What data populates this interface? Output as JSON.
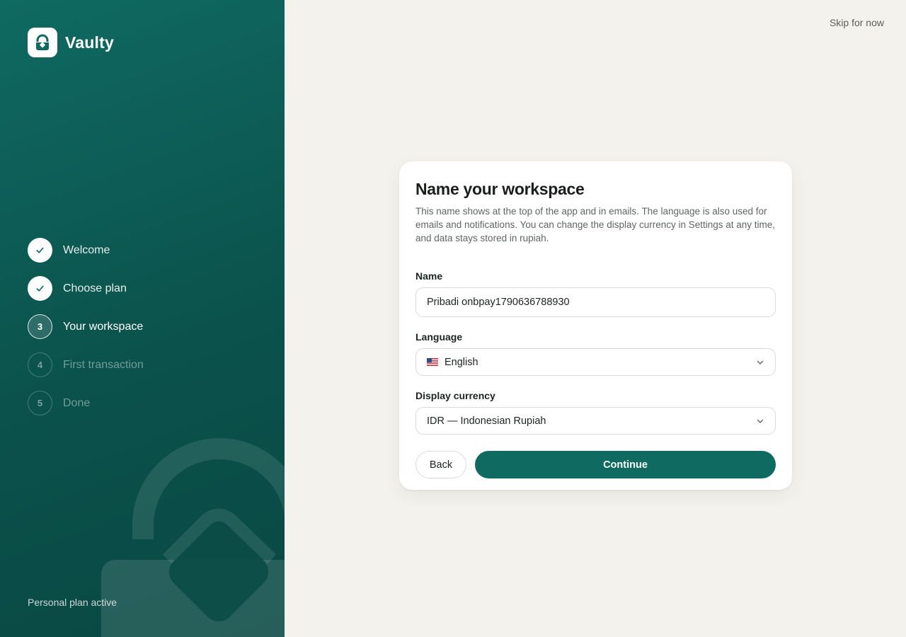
{
  "brand": {
    "name": "Vaulty",
    "icon": "lock-bag-icon"
  },
  "steps": [
    {
      "number": "1",
      "label": "Welcome",
      "state": "done"
    },
    {
      "number": "2",
      "label": "Choose plan",
      "state": "done"
    },
    {
      "number": "3",
      "label": "Your workspace",
      "state": "current"
    },
    {
      "number": "4",
      "label": "First transaction",
      "state": "todo"
    },
    {
      "number": "5",
      "label": "Done",
      "state": "todo"
    }
  ],
  "sidebar": {
    "plan_note": "Personal plan active"
  },
  "header": {
    "skip_label": "Skip for now"
  },
  "card": {
    "title": "Name your workspace",
    "description": "This name shows at the top of the app and in emails. The language is also used for emails and notifications. You can change the display currency in Settings at any time, and data stays stored in rupiah.",
    "name": {
      "label": "Name",
      "value": "Pribadi onbpay1790636788930"
    },
    "language": {
      "label": "Language",
      "value": "English",
      "flag_icon": "us-flag-icon"
    },
    "currency": {
      "label": "Display currency",
      "value": "IDR — Indonesian Rupiah"
    },
    "back_label": "Back",
    "continue_label": "Continue"
  },
  "colors": {
    "accent": "#0f6a62",
    "background": "#f4f2ec",
    "card": "#ffffff"
  }
}
